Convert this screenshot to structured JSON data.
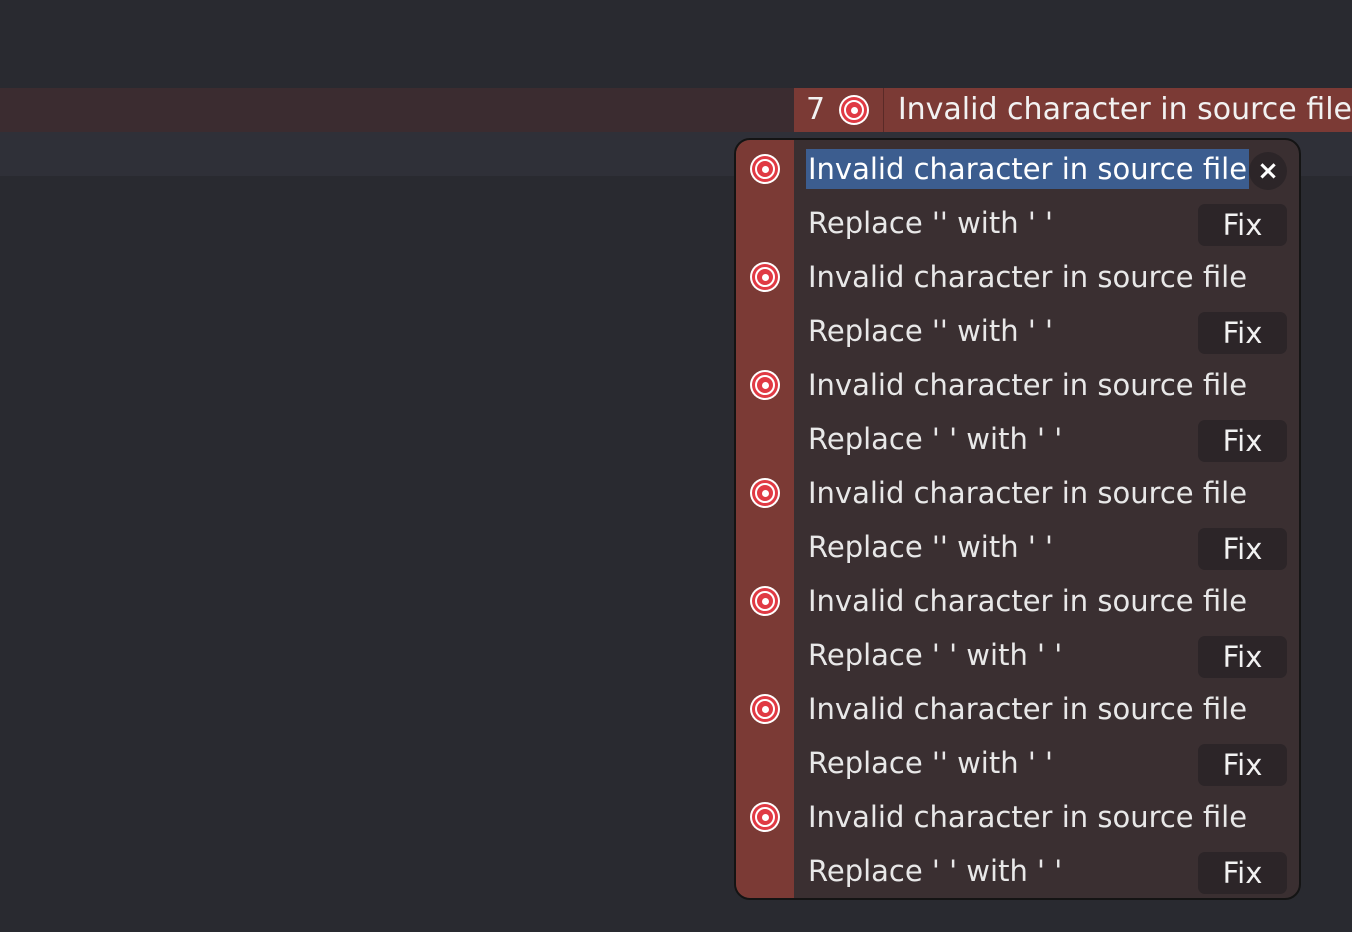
{
  "banner": {
    "count": "7",
    "message": "Invalid character in source file",
    "icon": "error-circle-icon"
  },
  "popover": {
    "close_label": "×",
    "items": [
      {
        "error": "Invalid character in source file",
        "fix_desc": "Replace '' with ' '",
        "fix_label": "Fix"
      },
      {
        "error": "Invalid character in source file",
        "fix_desc": "Replace '' with ' '",
        "fix_label": "Fix"
      },
      {
        "error": "Invalid character in source file",
        "fix_desc": "Replace ' ' with ' '",
        "fix_label": "Fix"
      },
      {
        "error": "Invalid character in source file",
        "fix_desc": "Replace '' with ' '",
        "fix_label": "Fix"
      },
      {
        "error": "Invalid character in source file",
        "fix_desc": "Replace ' ' with ' '",
        "fix_label": "Fix"
      },
      {
        "error": "Invalid character in source file",
        "fix_desc": "Replace '' with ' '",
        "fix_label": "Fix"
      },
      {
        "error": "Invalid character in source file",
        "fix_desc": "Replace ' ' with ' '",
        "fix_label": "Fix"
      }
    ]
  },
  "colors": {
    "editor_bg": "#292a30",
    "error_accent": "#7b3a35",
    "error_icon": "#e03a44",
    "selection": "#3c5d8f"
  }
}
